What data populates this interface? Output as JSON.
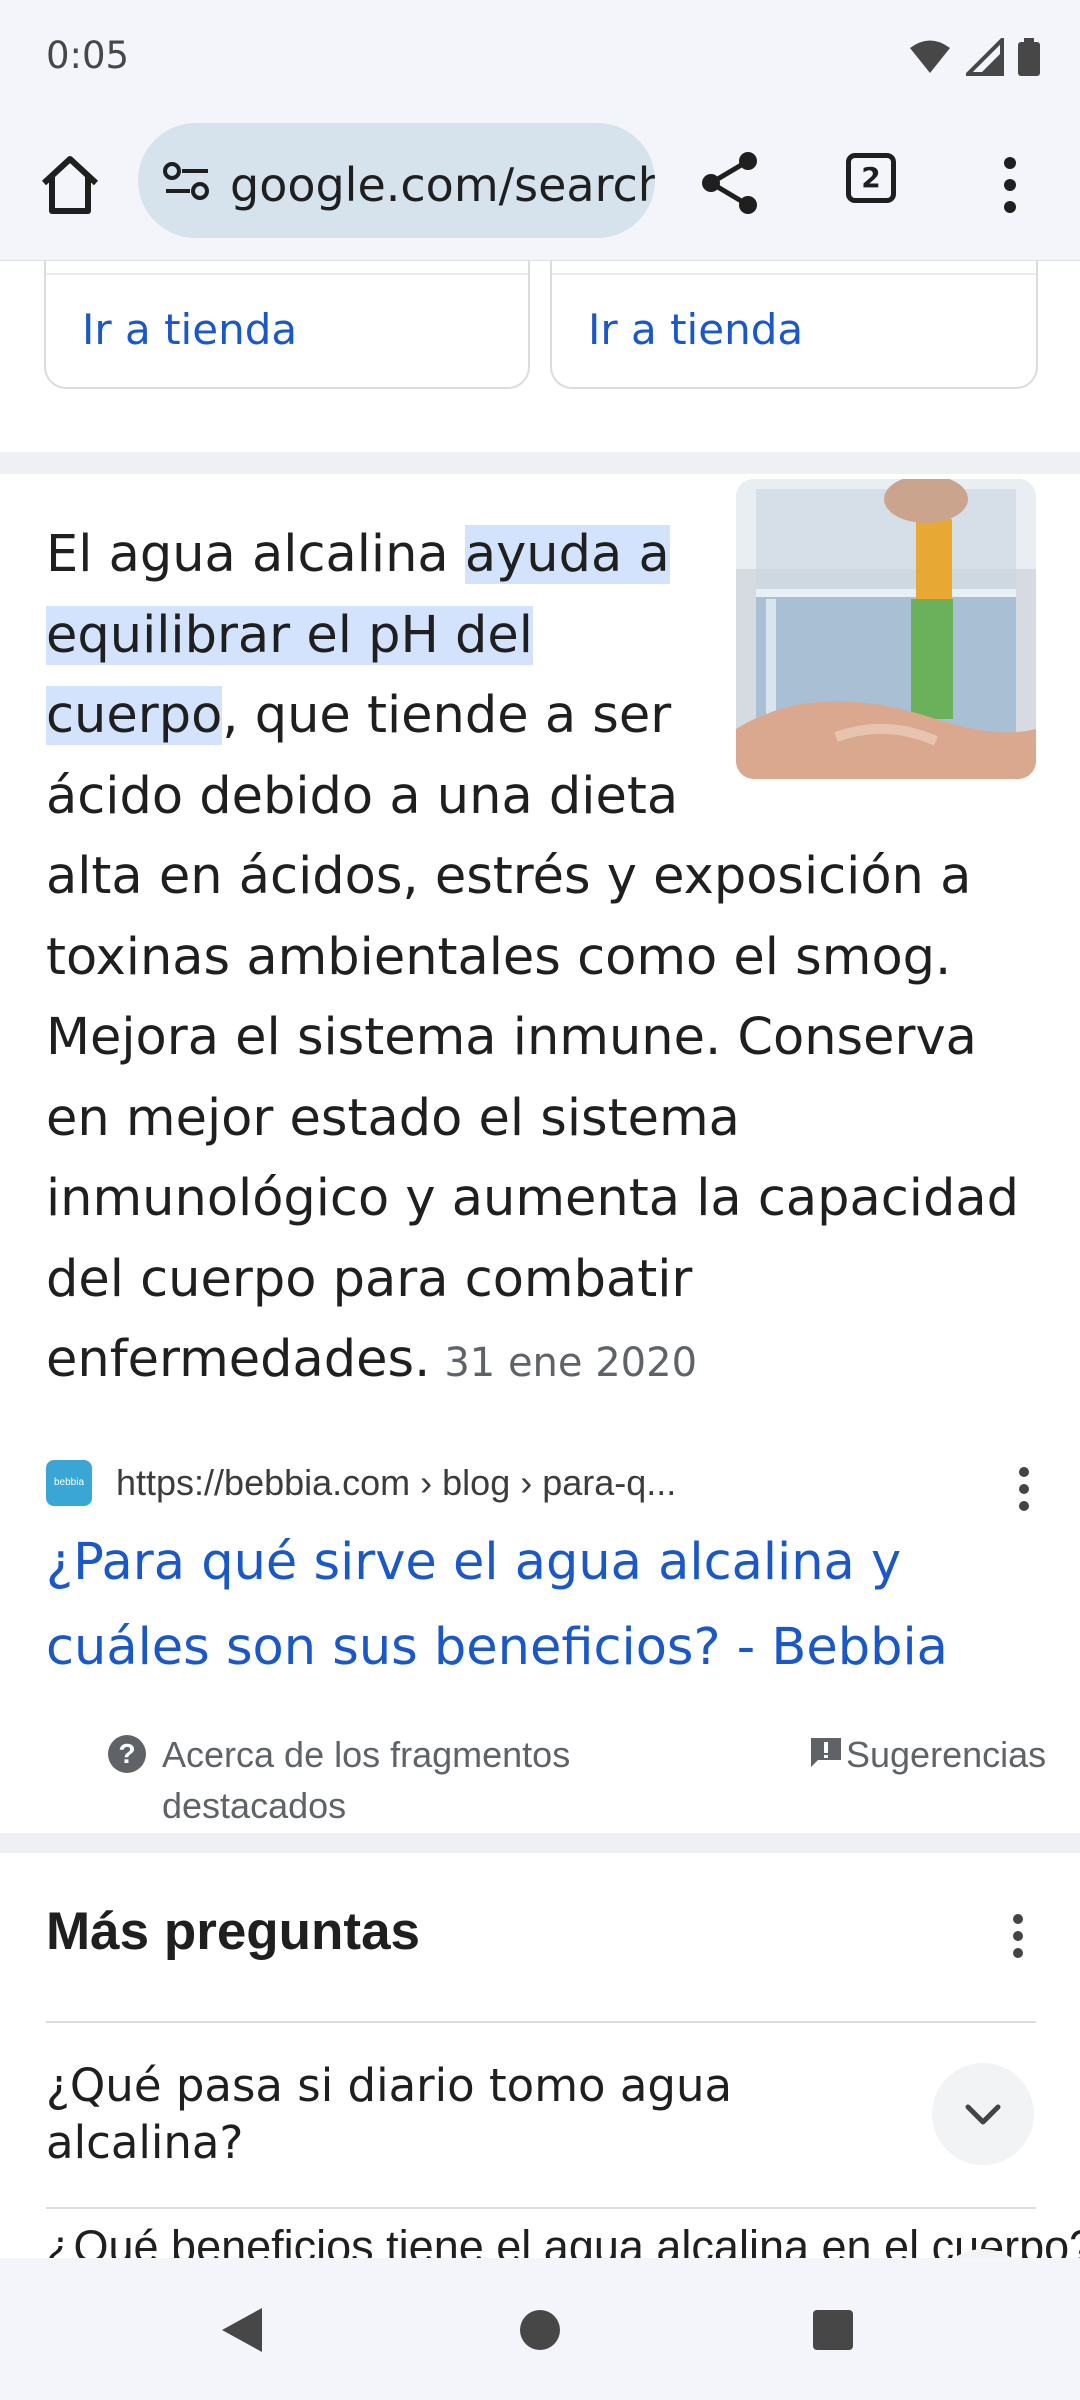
{
  "status_bar": {
    "time": "0:05"
  },
  "browser": {
    "url": "google.com/search",
    "tab_count": "2"
  },
  "shop_cards": [
    {
      "link": "Ir a tienda"
    },
    {
      "link": "Ir a tienda"
    }
  ],
  "snippet": {
    "lead": "El agua alcalina ",
    "highlight": "ayuda a equilibrar el pH del cuerpo",
    "body": ", que tiende a ser ácido debido a una dieta alta en ácidos, estrés y exposición a toxinas ambientales como el smog. Mejora el sistema inmune. Conserva en mejor estado el sistema inmunológico y aumenta la capacidad del cuerpo para combatir enfermedades.",
    "date": "31 ene 2020"
  },
  "source": {
    "favicon_label": "bebbia",
    "url": "https://bebbia.com › blog › para-q...",
    "title": "¿Para qué sirve el agua alcalina y cuáles son sus beneficios? - Bebbia"
  },
  "snippet_footer": {
    "about": "Acerca de los fragmentos destacados",
    "feedback": "Sugerencias"
  },
  "more_questions": {
    "title": "Más preguntas",
    "items": [
      {
        "question": "¿Qué pasa si diario tomo agua alcalina?"
      },
      {
        "question": "¿Qué beneficios tiene el agua alcalina en el cuerpo?"
      }
    ]
  },
  "icons": [
    "home-icon",
    "site-settings-icon",
    "share-icon",
    "tab-switcher-icon",
    "more-vert-icon",
    "help-icon",
    "feedback-icon",
    "chevron-down-icon",
    "nav-back-icon",
    "nav-home-icon",
    "nav-recents-icon"
  ]
}
